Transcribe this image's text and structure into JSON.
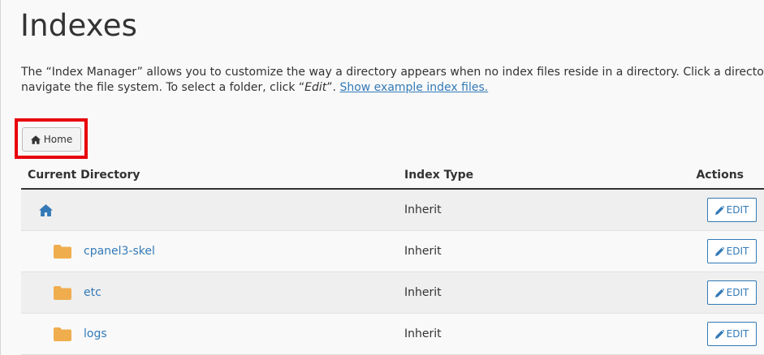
{
  "page": {
    "title": "Indexes",
    "description_line1": "The “Index Manager” allows you to customize the way a directory appears when no index files reside in a directory. Click a directory’s icon or n",
    "description_line2_prefix": "navigate the file system. To select a folder, click “",
    "description_line2_em": "Edit",
    "description_line2_suffix": "”. ",
    "example_link": "Show example index files."
  },
  "breadcrumb": {
    "home_label": "Home",
    "home_icon": "home-icon"
  },
  "table": {
    "headers": {
      "current_directory": "Current Directory",
      "index_type": "Index Type",
      "actions": "Actions"
    },
    "rows": [
      {
        "name": "",
        "icon": "home-icon",
        "index_type": "Inherit",
        "action": "EDIT"
      },
      {
        "name": "cpanel3-skel",
        "icon": "folder-icon",
        "index_type": "Inherit",
        "action": "EDIT"
      },
      {
        "name": "etc",
        "icon": "folder-icon",
        "index_type": "Inherit",
        "action": "EDIT"
      },
      {
        "name": "logs",
        "icon": "folder-icon",
        "index_type": "Inherit",
        "action": "EDIT"
      }
    ]
  },
  "colors": {
    "link": "#337ab7",
    "folder": "#f0ad4e",
    "highlight": "#e8000b"
  }
}
